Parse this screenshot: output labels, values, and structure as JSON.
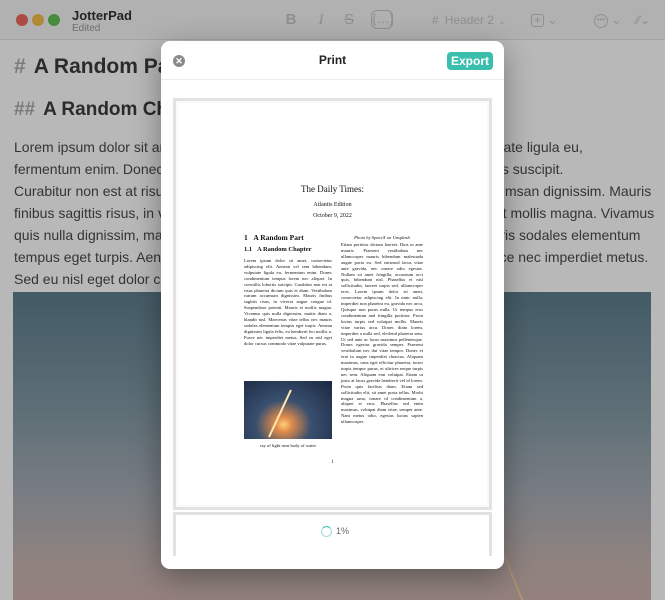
{
  "window": {
    "app_name": "JotterPad",
    "status": "Edited"
  },
  "toolbar": {
    "bold_glyph": "B",
    "italic_glyph": "I",
    "strike_glyph": "S",
    "code_glyph": "{…}",
    "heading_hash": "#",
    "heading_label": "Header 2",
    "heading_chevron": "⌄",
    "add_glyph": "+",
    "add_chevron": "⌄",
    "more_glyph": "•••",
    "more_chevron": "⌄",
    "wand_glyph": "⁄⁄",
    "wand_chevron": "⌄"
  },
  "editor": {
    "h1_marker": "#",
    "h1_text": "A Random Part",
    "h2_marker": "##",
    "h2_text": "A Random Chapter",
    "body_lines": [
      "Lorem ipsum dolor sit amet, consectetur adipiscing elit. Aenean vel sem, vulputate ligula eu,",
      "fermentum enim. Donec condimentum tempus lorem nec aliquet. Donec lobortis suscipit.",
      "Curabitur non est at risus pharetra dictum quis et diam. Vestibulum rutrum accumsan dignissim. Mauris",
      "finibus sagittis risus, in viverra augue congue id. Suspendisse potenti. Mauris et mollis magna. Vivamus",
      "quis nulla dignissim, mattis diam a, blandit nisl. Maecenas vitae tellus nec mauris sodales elementum",
      "tempus eget turpis. Aenean dignissim ligula felis, eu hendrerit leo mollis a. Fusce nec imperdiet metus.",
      "Sed eu nisl eget dolor cursus commodo vitae vulputate purus."
    ]
  },
  "dialog": {
    "close_glyph": "✕",
    "title": "Print",
    "export_label": "Export",
    "progress": "1%"
  },
  "print_page": {
    "title": "The Daily Times:",
    "subtitle": "Atlantis Edition",
    "date": "October 9, 2022",
    "section_num": "1",
    "section_title": "A Random Part",
    "subsection_num": "1.1",
    "subsection_title": "A Random Chapter",
    "col1_text": "Lorem ipsum dolor sit amet, consectetur adipiscing elit. Aenean vel sem bibendum, vulputate ligula eu, fermentum enim. Donec condimentum tempus lorem nec aliquet. In convallis lobortis suscipit. Curabitur non est at risus pharetra dictum quis et diam. Vestibulum rutrum accumsan dignissim. Mauris finibus sagittis risus, in viverra augue congue id. Suspendisse potenti. Mauris et mollis magna. Vivamus quis nulla dignissim, mattis diam a, blandit nisl. Maecenas vitae tellus nec mauris sodales elementum tempus eget turpis. Aenean dignissim ligula felis, eu hendrerit leo mollis a. Fusce nec imperdiet metus. Sed eu nisl eget dolor cursus commodo vitae vulputate purus.",
    "image_caption": "ray of light near body of water",
    "photo_credit": "Photo by SpaceX on Unsplash",
    "col2_text": "Etiam porttitor dictum laoreet. Duis ut ante mauris. Praesent vestibulum nec ullamcorper mauris bibendum malesuada augue porta eu. Sed euismod lacus vitae ante gravida, nec ornare odio egestas. Nullam sit amet fringilla, accumsan orci quis, bibendum nisl. Phasellus et nisl sollicitudin, laoreet turpis sed, ullamcorper eros. Lorem ipsum dolor sit amet, consectetur adipiscing elit. In nunc nulla, imperdiet non pharetra eu, gravida nec arcu. Quisque non purus nulla. Ut tempus eros condimentum and fringilla porttitor. Proin luctus turpis sed volutpat mollis. Mauris vitae varius arcu. Donec diam lorem, imperdiet a nulla sed, eleifend pharetra sem. Ut sed ante ac lacus maximus pellentesque. Donec egestas gravida semper. Praesent vestibulum nec dui vitae tempor. Donec et erat in augue imperdiet rhoncus. Aliquam maximus, urna eget efficitur pharetra, tortor turpis tempor purus, et ultrices neque turpis nec sem. Aliquam erat volutpat. Etiam ut justo at lacus gravida hendrerit vel id lorem. Proin quis facilisis diam. Etiam sed sollicitudin elit, sit amet porta tellus. Morbi magna urna, ornare id condimentum a, aliquet et eros. Phasellus sed enim maximus, volutpat diam vitae, semper ante. Nam metus odio, egestas luctus sapien ullamcorper.",
    "page_number": "1"
  }
}
